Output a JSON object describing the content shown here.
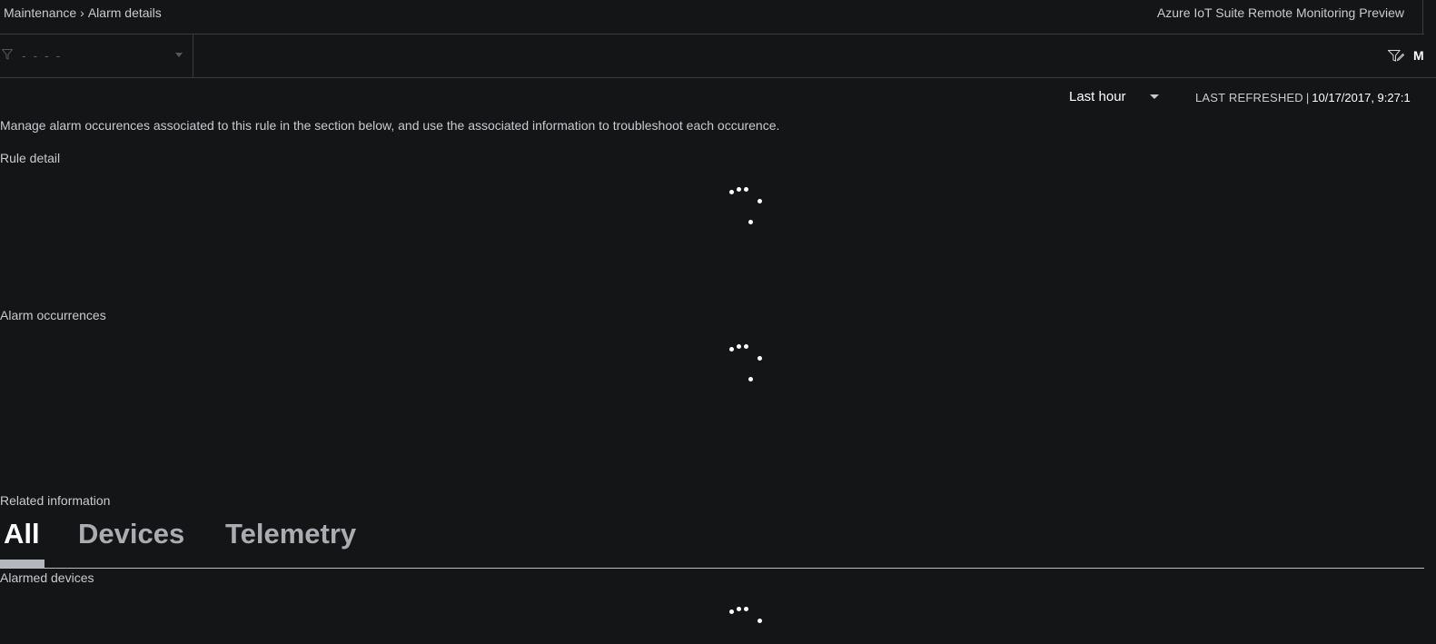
{
  "header": {
    "breadcrumb": [
      "Maintenance",
      "Alarm details"
    ],
    "breadcrumb_separator": "›",
    "app_title": "Azure IoT Suite Remote Monitoring Preview"
  },
  "filter_bar": {
    "device_group_value": "- - - -",
    "manage_label": "M"
  },
  "time_range": {
    "selected": "Last hour"
  },
  "refresh": {
    "label": "LAST REFRESHED",
    "separator": "|",
    "timestamp": "10/17/2017, 9:27:1"
  },
  "description": "Manage alarm occurences associated to this rule in the section below, and use the associated information to troubleshoot each occurence.",
  "sections": {
    "rule_detail": "Rule detail",
    "alarm_occurrences": "Alarm occurrences",
    "related_information": "Related information",
    "alarmed_devices": "Alarmed devices"
  },
  "tabs": [
    {
      "label": "All",
      "active": true
    },
    {
      "label": "Devices",
      "active": false
    },
    {
      "label": "Telemetry",
      "active": false
    }
  ],
  "colors": {
    "background": "#141517",
    "text": "#c8cbd0",
    "accent_text": "#ffffff",
    "divider": "#3a3b3d",
    "tab_inactive": "#a9acb1"
  },
  "icons": {
    "filter": "filter-icon",
    "manage_filters": "manage-filters-icon",
    "dropdown": "chevron-down-icon",
    "loading": "loading-spinner-icon"
  }
}
